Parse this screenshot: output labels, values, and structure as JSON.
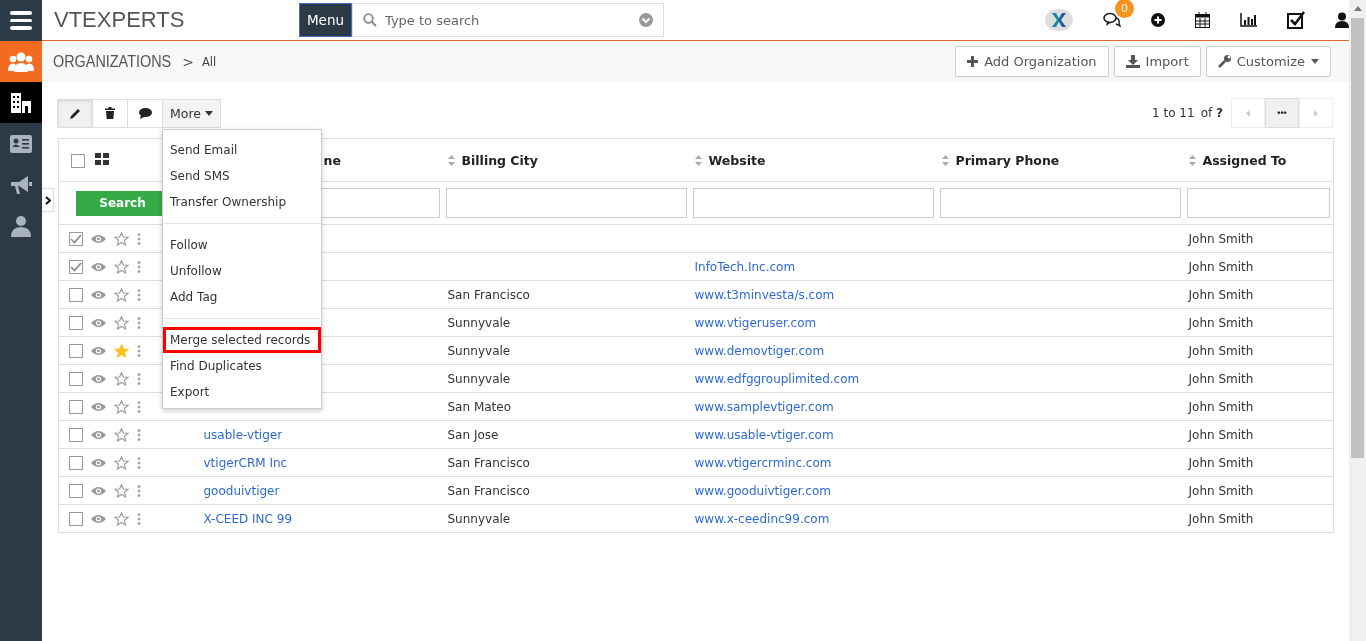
{
  "topbar": {
    "logo": "VTEXPERTS",
    "menu_button": "Menu",
    "search": {
      "placeholder": "Type to search"
    },
    "chat_badge": "0"
  },
  "sidebar": {
    "items": [
      {
        "kind": "people",
        "selected": false
      },
      {
        "kind": "building",
        "selected": true
      },
      {
        "kind": "card",
        "selected": false
      },
      {
        "kind": "megaphone",
        "selected": false
      },
      {
        "kind": "person",
        "selected": false
      }
    ]
  },
  "breadcrumb": {
    "module": "ORGANIZATIONS",
    "separator": ">",
    "view": "All"
  },
  "actions": [
    "Add Organization",
    "Import",
    "Customize"
  ],
  "toolbar": {
    "more": "More",
    "pagination": {
      "range": "1 to 11",
      "of": "of",
      "total": "?",
      "more": "•••"
    }
  },
  "more_menu": [
    {
      "label": "Send Email",
      "highlighted": false,
      "divider_before": false
    },
    {
      "label": "Send SMS",
      "highlighted": false,
      "divider_before": false
    },
    {
      "label": "Transfer Ownership",
      "highlighted": false,
      "divider_before": false
    },
    {
      "label": "Follow",
      "highlighted": false,
      "divider_before": true
    },
    {
      "label": "Unfollow",
      "highlighted": false,
      "divider_before": false
    },
    {
      "label": "Add Tag",
      "highlighted": false,
      "divider_before": false
    },
    {
      "label": "Merge selected records",
      "highlighted": true,
      "divider_before": true
    },
    {
      "label": "Find Duplicates",
      "highlighted": false,
      "divider_before": false
    },
    {
      "label": "Export",
      "highlighted": false,
      "divider_before": false
    }
  ],
  "table": {
    "select_all_checked": false,
    "columns": [
      "ne",
      "Billing City",
      "Website",
      "Primary Phone",
      "Assigned To"
    ],
    "search_button": "Search",
    "rows": [
      {
        "checked": true,
        "starred": false,
        "name": "",
        "city": "",
        "website": "",
        "assigned": "John Smith"
      },
      {
        "checked": true,
        "starred": false,
        "name": "",
        "city": "",
        "website": "InfoTech.Inc.com",
        "assigned": "John Smith"
      },
      {
        "checked": false,
        "starred": false,
        "name": "",
        "city": "San Francisco",
        "website": "www.t3minvesta/s.com",
        "assigned": "John Smith"
      },
      {
        "checked": false,
        "starred": false,
        "name": "",
        "city": "Sunnyvale",
        "website": "www.vtigeruser.com",
        "assigned": "John Smith"
      },
      {
        "checked": false,
        "starred": true,
        "name": "",
        "city": "Sunnyvale",
        "website": "www.demovtiger.com",
        "assigned": "John Smith"
      },
      {
        "checked": false,
        "starred": false,
        "name": "",
        "city": "Sunnyvale",
        "website": "www.edfggrouplimited.com",
        "assigned": "John Smith"
      },
      {
        "checked": false,
        "starred": false,
        "name": "",
        "city": "San Mateo",
        "website": "www.samplevtiger.com",
        "assigned": "John Smith"
      },
      {
        "checked": false,
        "starred": false,
        "name": "usable-vtiger",
        "city": "San Jose",
        "website": "www.usable-vtiger.com",
        "assigned": "John Smith"
      },
      {
        "checked": false,
        "starred": false,
        "name": "vtigerCRM Inc",
        "city": "San Francisco",
        "website": "www.vtigercrminc.com",
        "assigned": "John Smith"
      },
      {
        "checked": false,
        "starred": false,
        "name": "gooduivtiger",
        "city": "San Francisco",
        "website": "www.gooduivtiger.com",
        "assigned": "John Smith"
      },
      {
        "checked": false,
        "starred": false,
        "name": "X-CEED INC 99",
        "city": "Sunnyvale",
        "website": "www.x-ceedinc99.com",
        "assigned": "John Smith"
      }
    ]
  }
}
